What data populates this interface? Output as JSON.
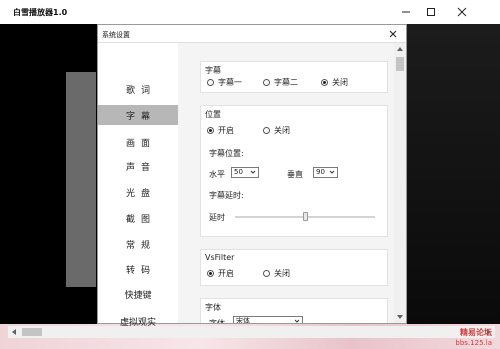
{
  "app": {
    "title": "白雪播放器1.0"
  },
  "dialog": {
    "title": "系统设置",
    "nav": [
      {
        "label": "歌词"
      },
      {
        "label": "字幕",
        "active": true
      },
      {
        "label": "画面"
      },
      {
        "label": "声音"
      },
      {
        "label": "光盘"
      },
      {
        "label": "截图"
      },
      {
        "label": "常规"
      },
      {
        "label": "转码"
      },
      {
        "label": "快捷键"
      },
      {
        "label": "虚拟观实"
      }
    ],
    "subtitle_group": {
      "title": "字幕",
      "options": [
        "字幕一",
        "字幕二",
        "关闭"
      ],
      "selected": "关闭"
    },
    "position_group": {
      "title": "位置",
      "options": [
        "开启",
        "关闭"
      ],
      "selected": "开启",
      "position_label": "字幕位置:",
      "horizontal_label": "水平",
      "horizontal_value": "50",
      "vertical_label": "垂直",
      "vertical_value": "90",
      "delay_heading": "字幕延时:",
      "delay_label": "延时",
      "delay_level": 0.5
    },
    "vsfilter_group": {
      "title": "VsFilter",
      "options": [
        "开启",
        "关闭"
      ],
      "selected": "开启"
    },
    "font_group": {
      "title": "字体",
      "font_label": "字体",
      "font_value": "宋体"
    }
  },
  "watermark": {
    "line1": "精易论坛",
    "line2": "bbs.125.la"
  },
  "colors": {
    "video": "#000000",
    "nav_active": "#b7b7b7",
    "content_bg": "#f4f4f4",
    "watermark": "#d23c3c"
  },
  "icons": [
    "minimize-icon",
    "maximize-icon",
    "close-icon",
    "dialog-close-icon",
    "scroll-up-icon",
    "scroll-down-icon",
    "scroll-left-icon",
    "scroll-right-icon",
    "chevron-down-icon"
  ]
}
